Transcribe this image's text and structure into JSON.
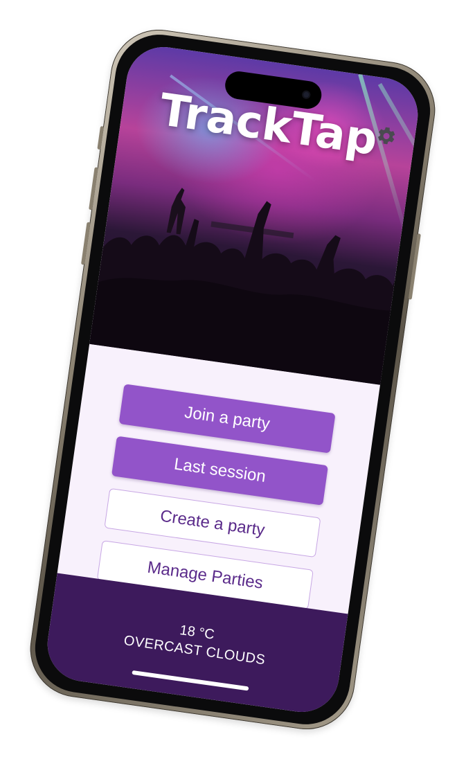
{
  "app": {
    "title": "TrackTap"
  },
  "icons": {
    "settings": "gear-icon"
  },
  "menu": {
    "join_label": "Join a party",
    "last_session_label": "Last session",
    "create_label": "Create a party",
    "manage_label": "Manage Parties"
  },
  "weather": {
    "temperature": "18 °C",
    "condition": "OVERCAST CLOUDS"
  },
  "colors": {
    "primary_button": "#9254c9",
    "outline_border": "#c7a6e4",
    "footer": "#3d1a5c",
    "screen_background": "#f8f1fc"
  }
}
